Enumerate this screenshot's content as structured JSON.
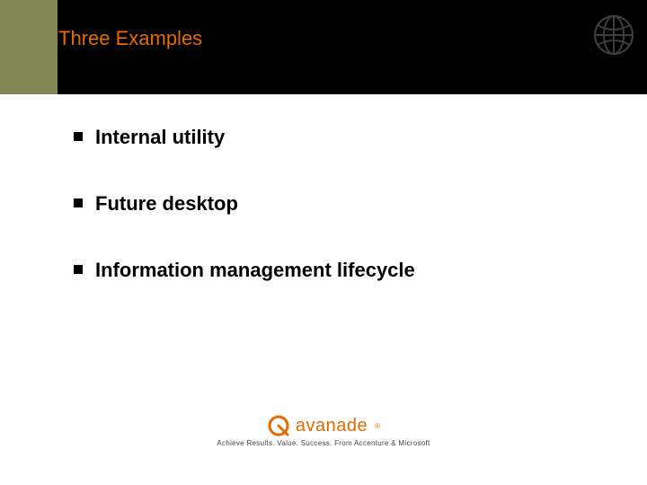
{
  "title": "Three Examples",
  "bullets": [
    "Internal utility",
    "Future desktop",
    "Information management lifecycle"
  ],
  "brand": {
    "name": "avanade",
    "registered": "®",
    "tagline": "Achieve Results. Value. Success. From Accenture & Microsoft"
  },
  "colors": {
    "accent": "#e26c00",
    "olive": "#848554"
  }
}
